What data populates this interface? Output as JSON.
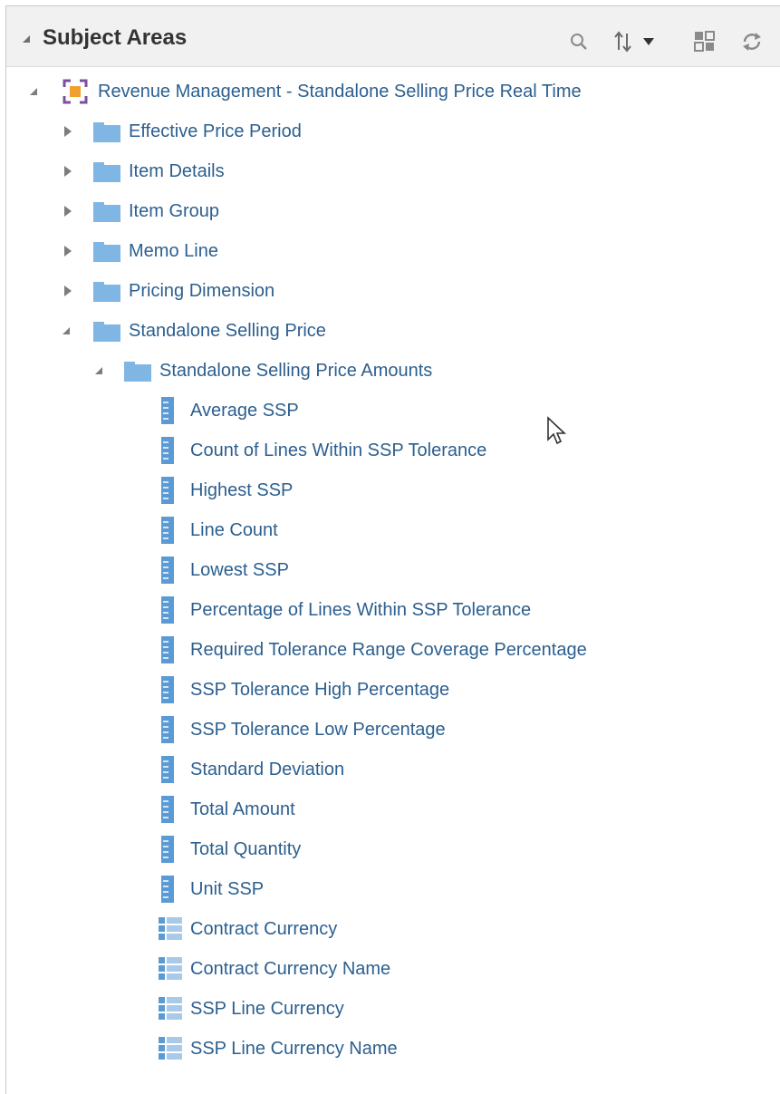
{
  "panel": {
    "title": "Subject Areas",
    "toolbar": [
      {
        "icon": "search-icon"
      },
      {
        "icon": "sort-icon"
      },
      {
        "icon": "dropdown-icon"
      },
      {
        "icon": "select-columns-icon"
      },
      {
        "icon": "refresh-icon"
      }
    ]
  },
  "tree": {
    "root": {
      "label": "Revenue Management - Standalone Selling Price Real Time",
      "icon": "subject-area-icon",
      "expanded": true
    },
    "folders": [
      {
        "label": "Effective Price Period",
        "expanded": false
      },
      {
        "label": "Item Details",
        "expanded": false
      },
      {
        "label": "Item Group",
        "expanded": false
      },
      {
        "label": "Memo Line",
        "expanded": false
      },
      {
        "label": "Pricing Dimension",
        "expanded": false
      },
      {
        "label": "Standalone Selling Price",
        "expanded": true
      }
    ],
    "subfolder": {
      "label": "Standalone Selling Price Amounts",
      "expanded": true
    },
    "measures": [
      "Average SSP",
      "Count of Lines Within SSP Tolerance",
      "Highest SSP",
      "Line Count",
      "Lowest SSP",
      "Percentage of Lines Within SSP Tolerance",
      "Required Tolerance Range Coverage Percentage",
      "SSP Tolerance High Percentage",
      "SSP Tolerance Low Percentage",
      "Standard Deviation",
      "Total Amount",
      "Total Quantity",
      "Unit SSP"
    ],
    "attributes": [
      "Contract Currency",
      "Contract Currency Name",
      "SSP Line Currency",
      "SSP Line Currency Name"
    ]
  },
  "colors": {
    "link": "#2c5f8f",
    "folder": "#7fb6e3",
    "measure": "#5b9bd5",
    "header_bg": "#f1f1f1"
  }
}
